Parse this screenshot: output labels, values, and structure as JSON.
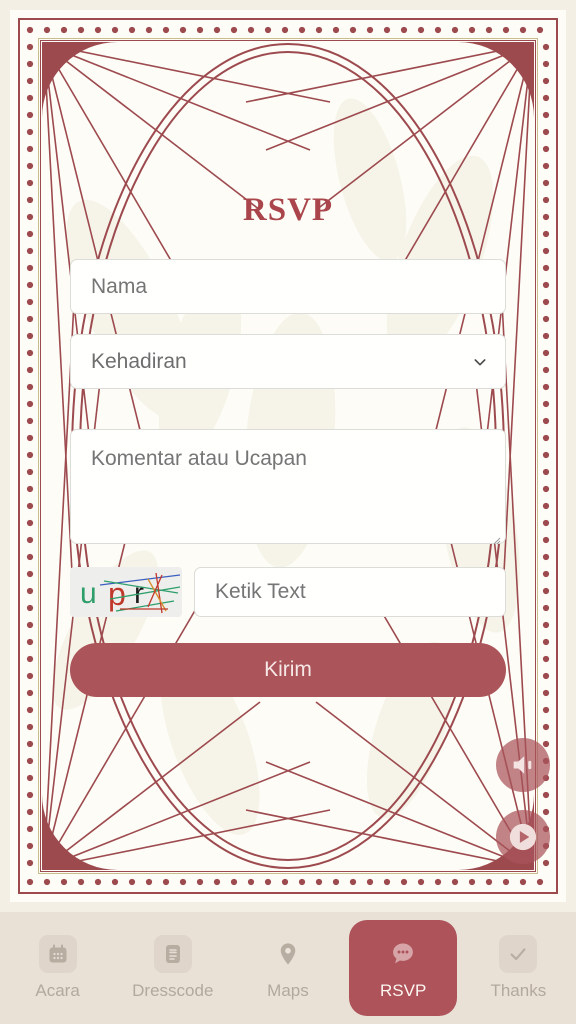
{
  "theme": {
    "accent": "#a9454b",
    "button": "#ab5459",
    "frame_line": "#9d4a4f",
    "gold_line": "#c9bd8e",
    "card_bg": "#fdfcf6",
    "page_bg": "#efe7dd",
    "nav_bg": "#e9e0d6",
    "nav_active_bg": "#ad5359",
    "nav_inactive_label": "#b2a99e"
  },
  "card": {
    "title": "RSVP"
  },
  "form": {
    "name_placeholder": "Nama",
    "name_value": "",
    "attendance_label": "Kehadiran",
    "attendance_value": "Kehadiran",
    "attendance_options": [
      "Kehadiran"
    ],
    "comment_placeholder": "Komentar atau Ucapan",
    "comment_value": "",
    "captcha_text": "upr",
    "captcha_letters": [
      {
        "char": "u",
        "color": "#2e9e6b"
      },
      {
        "char": "p",
        "color": "#c0392b"
      },
      {
        "char": "r",
        "color": "#1c1c1c"
      }
    ],
    "captcha_input_placeholder": "Ketik Text",
    "captcha_input_value": "",
    "submit_label": "Kirim"
  },
  "floating_buttons": [
    {
      "name": "music-toggle",
      "icon": "speaker-icon"
    },
    {
      "name": "play-toggle",
      "icon": "play-icon"
    }
  ],
  "bottom_nav": {
    "items": [
      {
        "label": "Acara",
        "icon": "calendar-icon",
        "active": false
      },
      {
        "label": "Dresscode",
        "icon": "document-icon",
        "active": false
      },
      {
        "label": "Maps",
        "icon": "location-pin-icon",
        "active": false
      },
      {
        "label": "RSVP",
        "icon": "chat-bubble-icon",
        "active": true
      },
      {
        "label": "Thanks",
        "icon": "check-icon",
        "active": false
      }
    ]
  }
}
